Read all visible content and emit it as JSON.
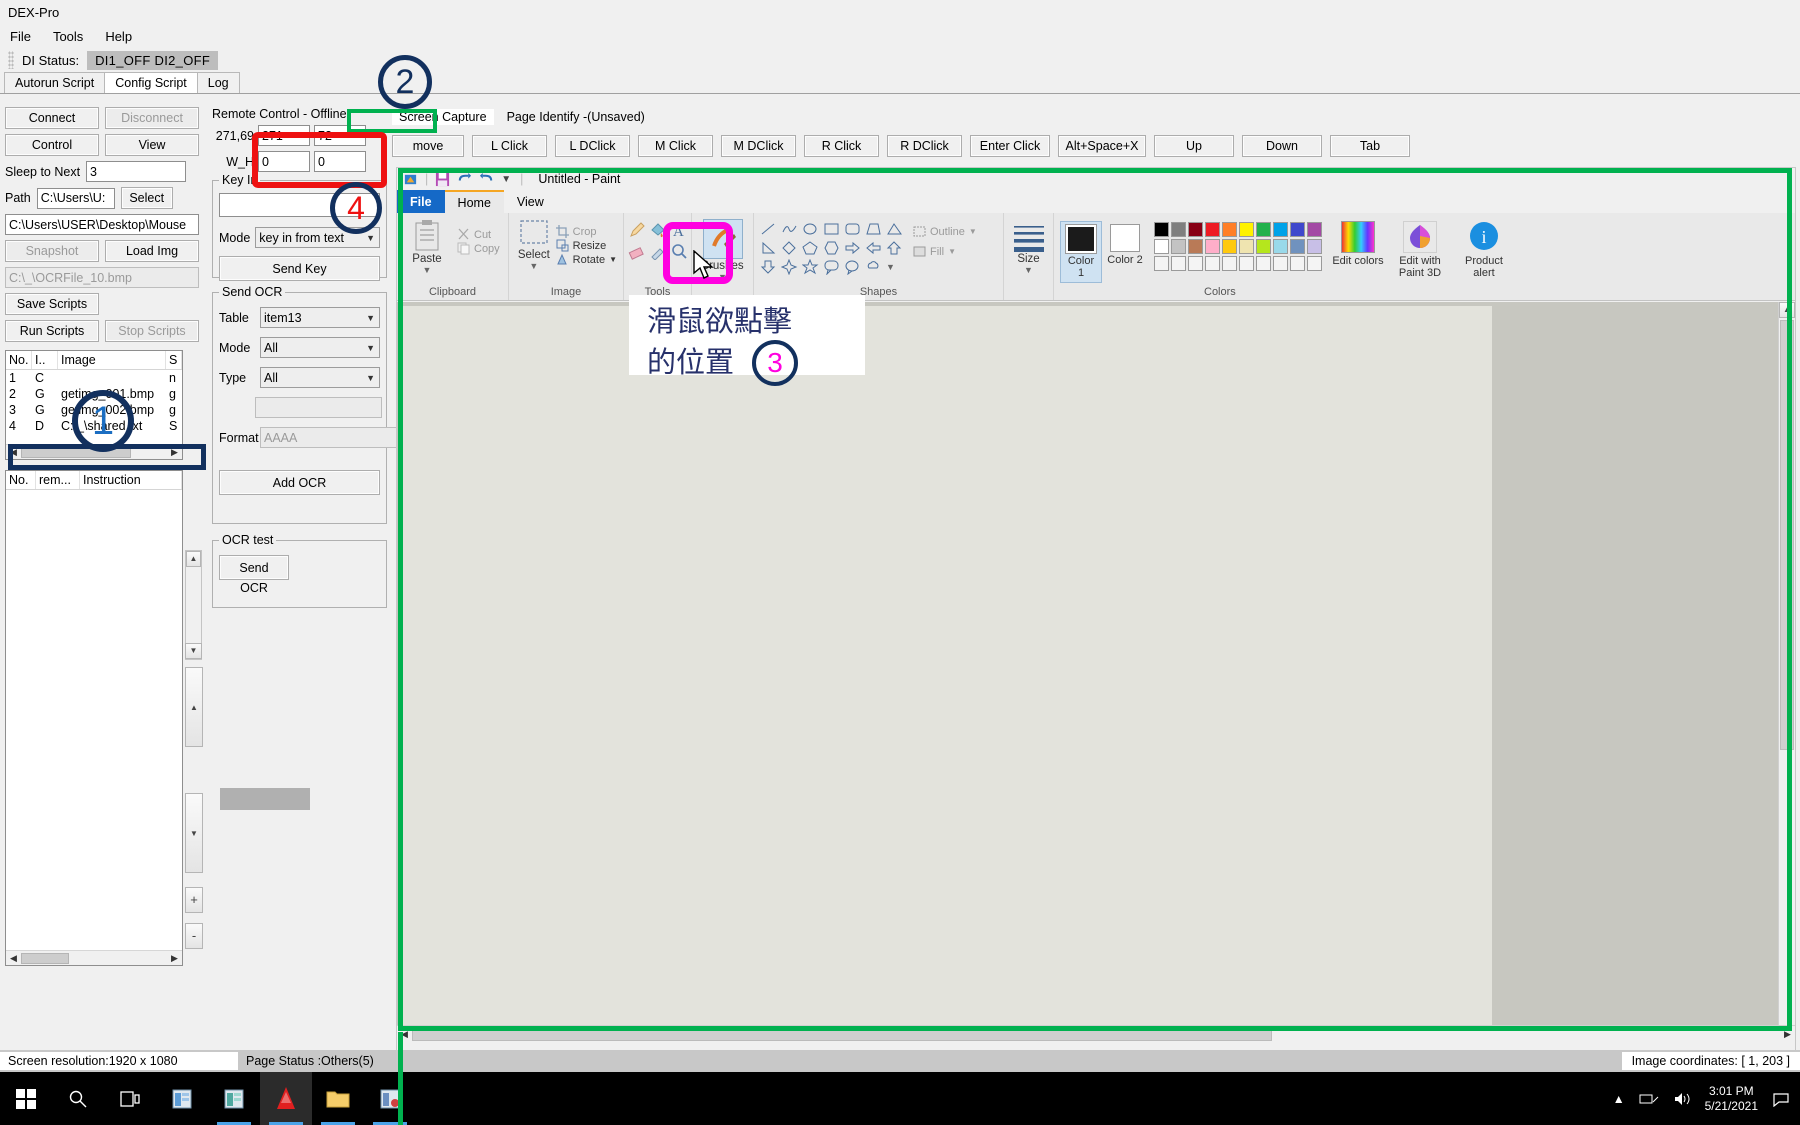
{
  "window": {
    "title": "DEX-Pro"
  },
  "menu": {
    "items": [
      "File",
      "Tools",
      "Help"
    ]
  },
  "di_status": {
    "label": "DI Status:",
    "value": "DI1_OFF  DI2_OFF"
  },
  "tabs": [
    {
      "label": "Autorun Script",
      "active": false
    },
    {
      "label": "Config Script",
      "active": true
    },
    {
      "label": "Log",
      "active": false
    }
  ],
  "left_panel": {
    "connect": "Connect",
    "disconnect": "Disconnect",
    "control": "Control",
    "view": "View",
    "sleep_label": "Sleep to Next",
    "sleep_value": "3",
    "path_label": "Path",
    "path_value": "C:\\Users\\U:",
    "select": "Select",
    "full_path": "C:\\Users\\USER\\Desktop\\Mouse",
    "snapshot": "Snapshot",
    "load_img": "Load Img",
    "ocr_file": "C:\\_\\OCRFile_10.bmp",
    "save_scripts": "Save Scripts",
    "run_scripts": "Run Scripts",
    "stop_scripts": "Stop Scripts",
    "script_table": {
      "headers": [
        "No.",
        "I..",
        "Image",
        "S"
      ],
      "rows": [
        {
          "no": "1",
          "i": "C",
          "image": "",
          "s": "n"
        },
        {
          "no": "2",
          "i": "G",
          "image": "getimg_001.bmp",
          "s": "g"
        },
        {
          "no": "3",
          "i": "G",
          "image": "getimg_002.bmp",
          "s": "g"
        },
        {
          "no": "4",
          "i": "D",
          "image": "C:\\_\\shared.txt",
          "s": "S"
        }
      ],
      "selected_index": 2
    },
    "instr_table": {
      "headers": [
        "No.",
        "rem...",
        "Instruction"
      ],
      "rows": []
    }
  },
  "remote_control": {
    "title": "Remote Control - Offline",
    "screen_capture_tab": "Screen Capture",
    "page_identify_tab": "Page Identify -(Unsaved)",
    "coord_label": "271,69",
    "x_value": "271",
    "y_value": "72",
    "wh_label": "W_H",
    "w_value": "0",
    "h_value": "0",
    "buttons": [
      "move",
      "L Click",
      "L DClick",
      "M Click",
      "M DClick",
      "R Click",
      "R DClick",
      "Enter Click",
      "Alt+Space+X",
      "Up",
      "Down",
      "Tab"
    ]
  },
  "key_in": {
    "title": "Key In",
    "value": "",
    "mode_label": "Mode",
    "mode_value": "key in from text",
    "send_key": "Send Key"
  },
  "send_ocr": {
    "title": "Send OCR",
    "table_label": "Table",
    "table_value": "item13",
    "mode_label": "Mode",
    "mode_value": "All",
    "type_label": "Type",
    "type_value": "All",
    "extra_value": "",
    "format_label": "Format",
    "format_value": "AAAA",
    "add_ocr": "Add OCR"
  },
  "ocr_test": {
    "title": "OCR test",
    "send_ocr": "Send OCR"
  },
  "paint": {
    "title": "Untitled - Paint",
    "tabs": [
      "File",
      "Home",
      "View"
    ],
    "groups": {
      "clipboard": {
        "name": "Clipboard",
        "paste": "Paste",
        "cut": "Cut",
        "copy": "Copy"
      },
      "image": {
        "name": "Image",
        "select": "Select",
        "crop": "Crop",
        "resize": "Resize",
        "rotate": "Rotate"
      },
      "tools": {
        "name": "Tools",
        "brushes": "Brushes"
      },
      "shapes": {
        "name": "Shapes",
        "outline": "Outline",
        "fill": "Fill"
      },
      "size": {
        "name": "",
        "label": "Size"
      },
      "colors": {
        "name": "Colors",
        "color1": "Color 1",
        "color2": "Color 2",
        "edit_colors": "Edit colors",
        "paint3d": "Edit with Paint 3D",
        "product_alert": "Product alert"
      }
    },
    "palette_row1": [
      "#000000",
      "#7f7f7f",
      "#880015",
      "#ed1c24",
      "#ff7f27",
      "#fff200",
      "#22b14c",
      "#00a2e8",
      "#3f48cc",
      "#a349a4"
    ],
    "palette_row2": [
      "#ffffff",
      "#c3c3c3",
      "#b97a57",
      "#ffaec9",
      "#ffc90e",
      "#efe4b0",
      "#b5e61d",
      "#99d9ea",
      "#7092be",
      "#c8bfe7"
    ]
  },
  "status_bar": {
    "resolution": "Screen resolution:1920 x 1080",
    "page_status": "Page Status :Others(5)",
    "image_coords": "Image coordinates: [ 1, 203 ]"
  },
  "taskbar": {
    "clock_time": "3:01 PM",
    "clock_date": "5/21/2021"
  },
  "annotations": {
    "n1": "1",
    "n2": "2",
    "n3": "3",
    "n4": "4",
    "note_line1": "滑鼠欲點擊",
    "note_line2": "的位置",
    "colors": {
      "navy": "#12305e",
      "green": "#00b14f",
      "red": "#ee1111",
      "magenta": "#ff00e0"
    }
  }
}
